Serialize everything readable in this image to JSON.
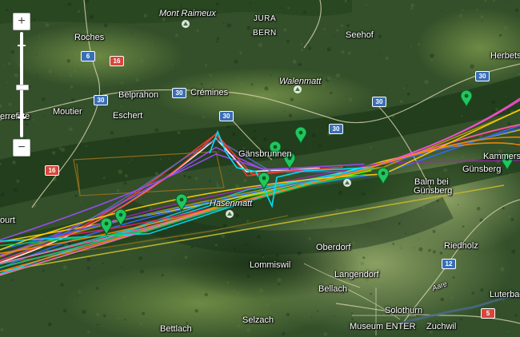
{
  "map": {
    "places": [
      {
        "key": "mont-raimeux",
        "text": "Mont Raimeux",
        "style": "it"
      },
      {
        "key": "jura",
        "text": "JURA",
        "style": "caps"
      },
      {
        "key": "bern",
        "text": "BERN",
        "style": "caps"
      },
      {
        "key": "seehof",
        "text": "Seehof",
        "style": ""
      },
      {
        "key": "roches",
        "text": "Roches",
        "style": ""
      },
      {
        "key": "herbetswil",
        "text": "Herbets",
        "style": ""
      },
      {
        "key": "walenmatt",
        "text": "Walenmatt",
        "style": "it"
      },
      {
        "key": "belprahon",
        "text": "Belprahon",
        "style": ""
      },
      {
        "key": "cremines",
        "text": "Crémines",
        "style": ""
      },
      {
        "key": "moutier",
        "text": "Moutier",
        "style": ""
      },
      {
        "key": "eschert",
        "text": "Eschert",
        "style": ""
      },
      {
        "key": "perrefitte",
        "text": "errefitte",
        "style": ""
      },
      {
        "key": "gansbrunnen",
        "text": "Gänsbrunnen",
        "style": ""
      },
      {
        "key": "kammersrohr",
        "text": "Kammers",
        "style": ""
      },
      {
        "key": "gunsberg",
        "text": "Günsberg",
        "style": ""
      },
      {
        "key": "balm-l1",
        "text": "Balm bei",
        "style": ""
      },
      {
        "key": "balm-l2",
        "text": "Günsberg",
        "style": ""
      },
      {
        "key": "court",
        "text": "ourt",
        "style": ""
      },
      {
        "key": "hasenmatt",
        "text": "Hasenmatt",
        "style": "it"
      },
      {
        "key": "riedholz",
        "text": "Riedholz",
        "style": ""
      },
      {
        "key": "oberdorf",
        "text": "Oberdorf",
        "style": ""
      },
      {
        "key": "lommiswil",
        "text": "Lommiswil",
        "style": ""
      },
      {
        "key": "langendorf",
        "text": "Langendorf",
        "style": ""
      },
      {
        "key": "bellach",
        "text": "Bellach",
        "style": ""
      },
      {
        "key": "solothurn",
        "text": "Solothurn",
        "style": ""
      },
      {
        "key": "luterbach",
        "text": "Luterbach",
        "style": ""
      },
      {
        "key": "bettlach",
        "text": "Bettlach",
        "style": ""
      },
      {
        "key": "selzach",
        "text": "Selzach",
        "style": ""
      },
      {
        "key": "museum-enter",
        "text": "Museum ENTER",
        "style": ""
      },
      {
        "key": "zuchwil",
        "text": "Zuchwil",
        "style": ""
      },
      {
        "key": "aare",
        "text": "Aare",
        "style": "it"
      }
    ],
    "road_shields": [
      {
        "key": "r6",
        "text": "6",
        "color": "#3a6fb5"
      },
      {
        "key": "r16a",
        "text": "16",
        "color": "#d9463b"
      },
      {
        "key": "r30a",
        "text": "30",
        "color": "#3a6fb5"
      },
      {
        "key": "r30b",
        "text": "30",
        "color": "#3a6fb5"
      },
      {
        "key": "r30c",
        "text": "30",
        "color": "#3a6fb5"
      },
      {
        "key": "r30d",
        "text": "30",
        "color": "#3a6fb5"
      },
      {
        "key": "r30e",
        "text": "30",
        "color": "#3a6fb5"
      },
      {
        "key": "r30f",
        "text": "30",
        "color": "#3a6fb5"
      },
      {
        "key": "r16b",
        "text": "16",
        "color": "#d9463b"
      },
      {
        "key": "r12",
        "text": "12",
        "color": "#3a6fb5"
      },
      {
        "key": "r5",
        "text": "5",
        "color": "#d9463b"
      }
    ],
    "markers": {
      "count": 9,
      "color": "#22c55e",
      "icon": "map-pin-icon"
    },
    "flight_tracks": {
      "count": 24,
      "colors": [
        "#ff3b30",
        "#2f6bff",
        "#00e0ff",
        "#ff4fd8",
        "#a24bff",
        "#ffd400",
        "#00c853",
        "#ff8a00",
        "#ffffff",
        "#9c27b0",
        "#1ec8c8",
        "#e91e63",
        "#5c6bc0",
        "#b8a300",
        "#7cfc00",
        "#ff66aa"
      ]
    },
    "zoom_control": {
      "zoom_in": "+",
      "zoom_out": "−",
      "level_fraction": 0.48
    }
  }
}
